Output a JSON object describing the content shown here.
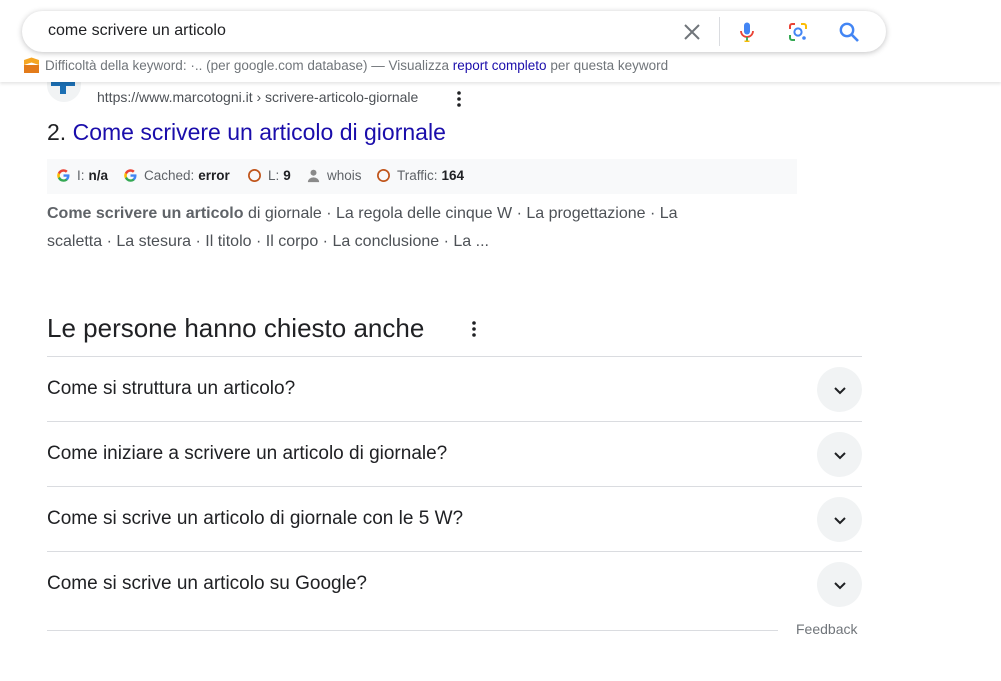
{
  "search": {
    "query": "come scrivere un articolo"
  },
  "keyword_bar": {
    "prefix": "Difficoltà della keyword:",
    "dots": "·..",
    "db": "(per google.com database) — Visualizza",
    "report_link": "report completo",
    "suffix": "per questa keyword"
  },
  "result": {
    "url": "https://www.marcotogni.it › scrivere-articolo-giornale",
    "number": "2.",
    "title": "Come scrivere un articolo di giornale",
    "seo": {
      "index_label": "I:",
      "index_value": "n/a",
      "cached_label": "Cached:",
      "cached_value": "error",
      "links_label": "L:",
      "links_value": "9",
      "whois_label": "whois",
      "traffic_label": "Traffic:",
      "traffic_value": "164"
    },
    "snippet_bold": "Come scrivere un articolo",
    "snippet_line1": " di giornale · La regola delle cinque W · La progettazione · La",
    "snippet_line2": "scaletta · La stesura · Il titolo · Il corpo · La conclusione · La ..."
  },
  "paa": {
    "heading": "Le persone hanno chiesto anche",
    "questions": [
      "Come si struttura un articolo?",
      "Come iniziare a scrivere un articolo di giornale?",
      "Come si scrive un articolo di giornale con le 5 W?",
      "Come si scrive un articolo su Google?"
    ],
    "feedback": "Feedback"
  },
  "colors": {
    "link": "#1a0dab",
    "mic_blue": "#4285f4",
    "mic_red": "#ea4335",
    "accent_orange": "#c0551b"
  }
}
